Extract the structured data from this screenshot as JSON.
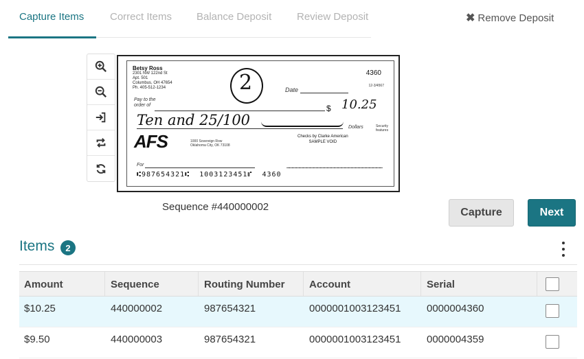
{
  "tabs": [
    {
      "label": "Capture Items",
      "active": true
    },
    {
      "label": "Correct Items",
      "active": false
    },
    {
      "label": "Balance Deposit",
      "active": false
    },
    {
      "label": "Review Deposit",
      "active": false
    }
  ],
  "remove_deposit": {
    "icon": "close-icon",
    "label": "Remove Deposit"
  },
  "toolbar": {
    "icons": [
      "zoom-in-icon",
      "zoom-out-icon",
      "sign-in-icon",
      "rotate-icon",
      "refresh-icon"
    ]
  },
  "check": {
    "name": "Betsy Ross",
    "address": "2301 NW 122nd St\nApt. 501\nColumbus, OH 47654\nPh. 405-512-1234",
    "number": "4360",
    "fraction": "12-3/4567",
    "date_label": "Date",
    "pay_to": "Pay to the\norder of",
    "dollar_sign": "$",
    "amount_handwritten": "10.25",
    "words_handwritten": "Ten and 25/100",
    "dollars_label": "Dollars",
    "lock_text": "Security features",
    "logo": "AFS",
    "bank_address": "1000 Sovereign Row\nOklahoma City, OK 73108",
    "printer": "Checks by Clarke American\nSAMPLE VOID",
    "for_label": "For",
    "micr": "⑆987654321⑆  1003123451⑈  4360",
    "circled_number": "2"
  },
  "sequence": "Sequence #440000002",
  "buttons": {
    "capture": "Capture",
    "next": "Next"
  },
  "items": {
    "title": "Items",
    "count": "2",
    "columns": [
      "Amount",
      "Sequence",
      "Routing Number",
      "Account",
      "Serial"
    ],
    "rows": [
      {
        "amount": "$10.25",
        "sequence": "440000002",
        "routing": "987654321",
        "account": "0000001003123451",
        "serial": "0000004360"
      },
      {
        "amount": "$9.50",
        "sequence": "440000003",
        "routing": "987654321",
        "account": "0000001003123451",
        "serial": "0000004359"
      }
    ]
  },
  "colors": {
    "accent": "#1b7583",
    "row_highlight": "#e7f8fd"
  }
}
